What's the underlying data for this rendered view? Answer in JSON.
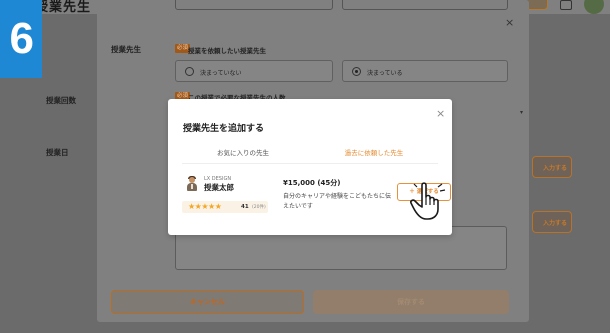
{
  "step_badge": "6",
  "header": {
    "title": "授業先生"
  },
  "background": {
    "right_button_label": "入力する"
  },
  "outer_modal": {
    "close_glyph": "×",
    "teacher_section": {
      "label": "授業先生",
      "required": "必須",
      "question": "授業を依頼したい授業先生",
      "options": [
        "決まっていない",
        "決まっている"
      ],
      "selected_index": 1
    },
    "count_section": {
      "label": "授業回数",
      "required": "必須",
      "question": "この授業で必要な授業先生の人数"
    },
    "date_section": {
      "label": "授業日"
    },
    "cancel_label": "キャンセル",
    "save_label": "保存する"
  },
  "inner_modal": {
    "title": "授業先生を追加する",
    "close_glyph": "×",
    "tabs": [
      {
        "label": "お気に入りの先生",
        "active": false
      },
      {
        "label": "過去に依頼した先生",
        "active": true
      }
    ],
    "teacher": {
      "company": "LX DESIGN",
      "name": "授業太郎",
      "stars": "★★★★★",
      "rating": "41",
      "review_count": "(20件)",
      "price": "¥15,000 (45分)",
      "description": "自分のキャリアや経験をこどもたちに伝えたいです",
      "select_label": "＋ 選択する"
    }
  },
  "colors": {
    "accent": "#e38a2f",
    "badge_blue": "#1e88d4",
    "star": "#f5a623"
  },
  "icons": {
    "pointer": "pointing-hand-icon",
    "avatar": "teacher-avatar-icon",
    "user": "user-avatar-icon"
  }
}
